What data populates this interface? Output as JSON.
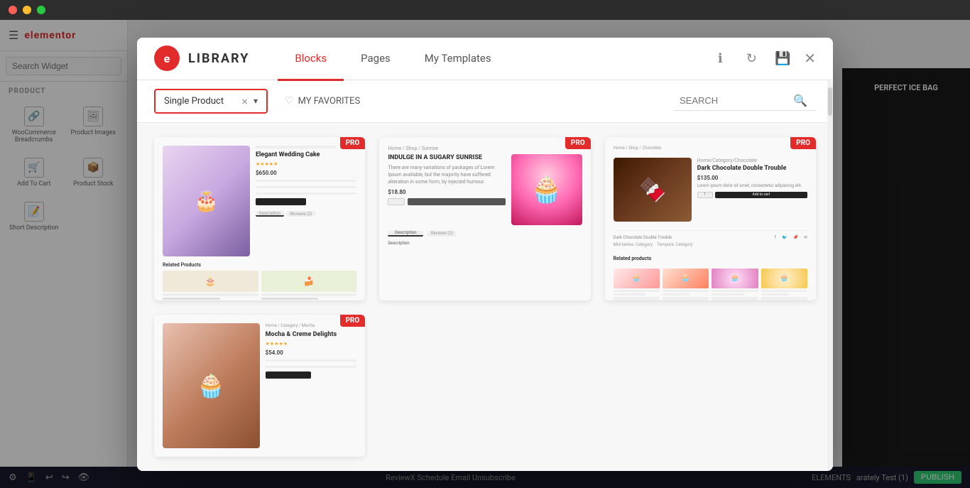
{
  "window": {
    "title": "Elementor"
  },
  "app": {
    "sidebar": {
      "logo": "elementor",
      "search_placeholder": "Search Widget",
      "section_label": "PRODUCT",
      "widgets": [
        {
          "id": "woocommerce-breadcrumbs",
          "icon": "🔗",
          "label": "WooCommerce Breadcrumbs"
        },
        {
          "id": "product-images",
          "icon": "🖼",
          "label": "Product Images"
        },
        {
          "id": "add-to-cart",
          "icon": "🛒",
          "label": "Add To Cart"
        },
        {
          "id": "product-stock",
          "icon": "📦",
          "label": "Product Stock"
        },
        {
          "id": "short-description",
          "icon": "📝",
          "label": "Short Description"
        }
      ]
    },
    "top_right": {
      "brand_text": "PERFECT ICE BAG",
      "search_icon": "🔍"
    },
    "bottom": {
      "notification": "ReviewX Schedule Email Unsubscribe",
      "elements_label": "ELEMENTS",
      "recently_label": "arately Test (1)",
      "publish_label": "PUBLISH"
    }
  },
  "library": {
    "logo_letter": "e",
    "title": "LIBRARY",
    "tabs": [
      {
        "id": "blocks",
        "label": "Blocks",
        "active": true
      },
      {
        "id": "pages",
        "label": "Pages",
        "active": false
      },
      {
        "id": "my-templates",
        "label": "My Templates",
        "active": false
      }
    ],
    "header_icons": {
      "info": "ℹ",
      "refresh": "↻",
      "save": "💾",
      "close": "✕"
    },
    "filter": {
      "label": "Single Product",
      "clear_icon": "×",
      "arrow_icon": "▾"
    },
    "favorites": {
      "icon": "♡",
      "label": "MY FAVORITES"
    },
    "search": {
      "placeholder": "SEARCH",
      "icon": "🔍"
    },
    "templates": [
      {
        "id": "wedding-cake",
        "badge": "PRO",
        "title": "Elegant Wedding Cake",
        "price": "$650.00",
        "type": "wedding"
      },
      {
        "id": "sugar-sunrise",
        "badge": "PRO",
        "title": "Indulge in a Sugary Sunrise",
        "price": "$18.80",
        "type": "cupcake"
      },
      {
        "id": "dark-chocolate",
        "badge": "PRO",
        "title": "Dark Chocolate Double Trouble",
        "price": "$135.00",
        "type": "chocolate"
      },
      {
        "id": "mocha-creme",
        "badge": "PRO",
        "title": "Mocha & Creme Delights",
        "price": "$54.00",
        "type": "mocha"
      }
    ]
  }
}
